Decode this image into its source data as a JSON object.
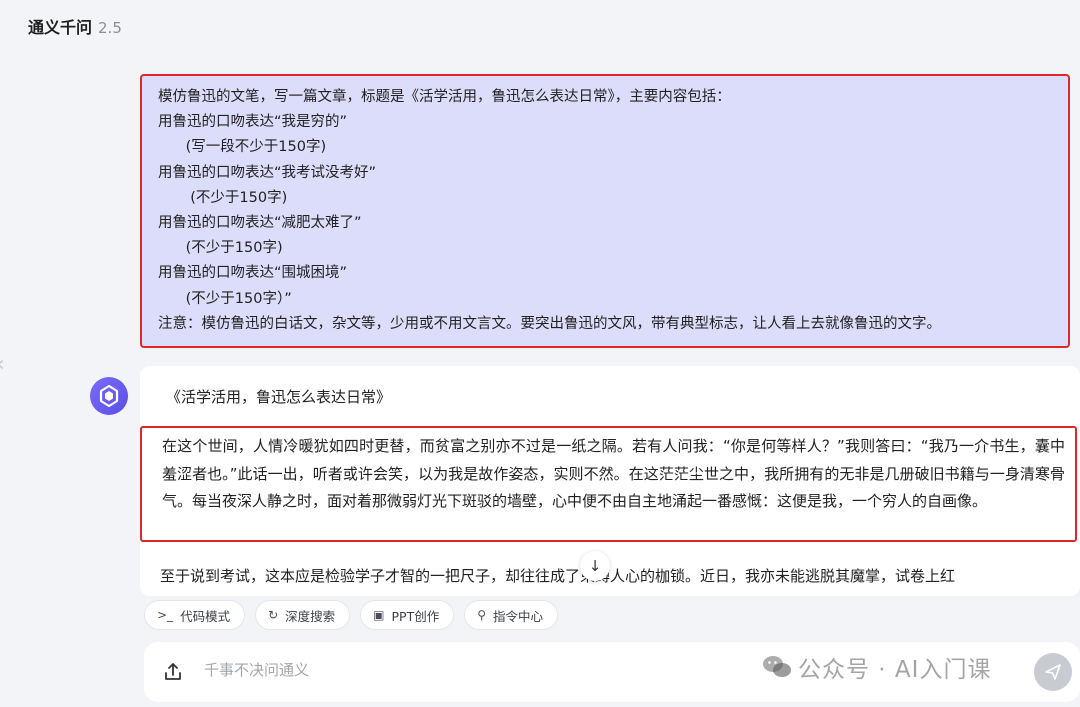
{
  "header": {
    "app_name": "通义千问",
    "version": "2.5"
  },
  "user_message": {
    "lines": [
      "模仿鲁迅的文笔，写一篇文章，标题是《活学活用，鲁迅怎么表达日常》，主要内容包括：",
      "用鲁迅的口吻表达“我是穷的”",
      "      (写一段不少于150字)",
      "用鲁迅的口吻表达“我考试没考好”",
      "       (不少于150字)",
      "用鲁迅的口吻表达“减肥太难了”",
      "      (不少于150字)",
      "用鲁迅的口吻表达“围城困境”",
      "      (不少于150字）”",
      "注意：模仿鲁迅的白话文，杂文等，少用或不用文言文。要突出鲁迅的文风，带有典型标志，让人看上去就像鲁迅的文字。"
    ]
  },
  "reply": {
    "title": "《活学活用，鲁迅怎么表达日常》",
    "paragraph1": "在这个世间，人情冷暖犹如四时更替，而贫富之别亦不过是一纸之隔。若有人问我：“你是何等样人？”我则答曰：“我乃一介书生，囊中羞涩者也。”此话一出，听者或许会笑，以为我是故作姿态，实则不然。在这茫茫尘世之中，我所拥有的无非是几册破旧书籍与一身清寒骨气。每当夜深人静之时，面对着那微弱灯光下斑驳的墙壁，心中便不由自主地涌起一番感慨：这便是我，一个穷人的自画像。",
    "paragraph2": "至于说到考试，这本应是检验学子才智的一把尺子，却往往成了束缚人心的枷锁。近日，我亦未能逃脱其魔掌，试卷上红"
  },
  "chips": [
    {
      "icon": "code-mode-icon",
      "glyph": ">_",
      "label": "代码模式"
    },
    {
      "icon": "deep-search-icon",
      "glyph": "↻",
      "label": "深度搜索"
    },
    {
      "icon": "ppt-icon",
      "glyph": "▣",
      "label": "PPT创作"
    },
    {
      "icon": "command-center-icon",
      "glyph": "⚲",
      "label": "指令中心"
    }
  ],
  "input": {
    "placeholder": "千事不决问通义"
  },
  "watermark": {
    "text": "公众号 · AI入门课"
  },
  "colors": {
    "highlight_border": "#e0262b",
    "user_bubble": "#dcdcfb",
    "avatar": "#6a5cf0"
  }
}
